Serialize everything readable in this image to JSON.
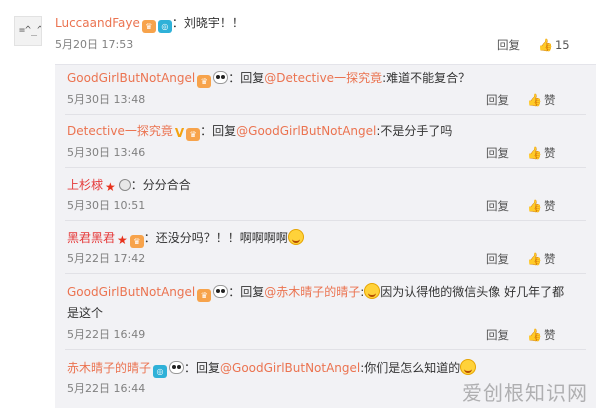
{
  "main_comment": {
    "username": "LuccaandFaye",
    "text": "：刘晓宇！！",
    "time": "5月20日 17:53",
    "reply_label": "回复",
    "like_count": "15"
  },
  "replies": [
    {
      "username": "GoodGirlButNotAngel",
      "prefix": "：回复",
      "mention": "@Detective一探究竟",
      "text": ":难道不能复合？",
      "time": "5月30日 13:48",
      "reply_label": "回复",
      "like_label": "赞"
    },
    {
      "username": "Detective一探究竟",
      "prefix": "：回复",
      "mention": "@GoodGirlButNotAngel",
      "text": ":不是分手了吗",
      "time": "5月30日 13:46",
      "reply_label": "回复",
      "like_label": "赞"
    },
    {
      "username": "上杉梂",
      "text": "：分分合合",
      "time": "5月30日 10:51",
      "reply_label": "回复",
      "like_label": "赞"
    },
    {
      "username": "黑君黑君",
      "text": "：还没分吗？！！啊啊啊啊",
      "time": "5月22日 17:42",
      "reply_label": "回复",
      "like_label": "赞"
    },
    {
      "username": "GoodGirlButNotAngel",
      "prefix": "：回复",
      "mention": "@赤木晴子的晴子",
      "text": ":",
      "text2": "因为认得他的微信头像 好几年了都",
      "text3": "是这个",
      "time": "5月22日 16:49",
      "reply_label": "回复",
      "like_label": "赞"
    },
    {
      "username": "赤木晴子的晴子",
      "prefix": "：回复",
      "mention": "@GoodGirlButNotAngel",
      "text": ":你们是怎么知道的",
      "time": "5月22日 16:44",
      "reply_label": "回复",
      "like_label": "赞"
    }
  ],
  "watermark": "爱创根知识网",
  "colors": {
    "username": "#eb7350",
    "reply_bg": "#f2f2f5",
    "time": "#808080"
  }
}
